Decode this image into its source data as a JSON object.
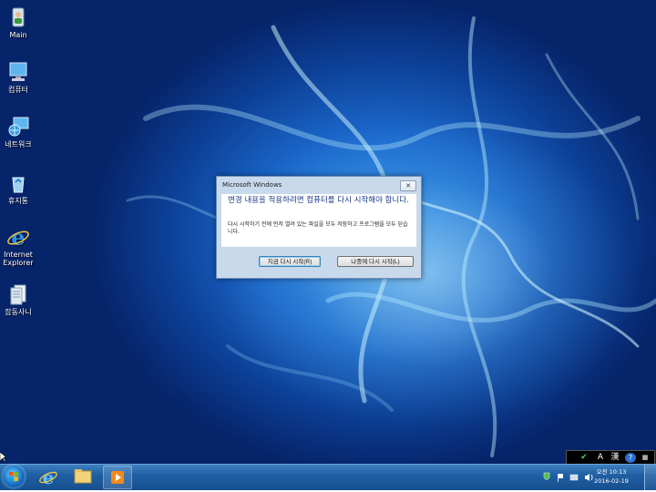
{
  "desktop": {
    "icons": [
      {
        "id": "main",
        "label": "Main"
      },
      {
        "id": "computer",
        "label": "컴퓨터"
      },
      {
        "id": "network",
        "label": "네트워크"
      },
      {
        "id": "recycle-bin",
        "label": "휴지통"
      },
      {
        "id": "ie",
        "label": "Internet Explorer"
      },
      {
        "id": "shared-docs",
        "label": "잡동사니"
      }
    ]
  },
  "dialog": {
    "title": "Microsoft Windows",
    "close_glyph": "✕",
    "main_instruction": "변경 내용을 적용하려면 컴퓨터를 다시 시작해야 합니다.",
    "detail": "다시 시작하기 전에 먼저 열려 있는 파일을 모두 저장하고 프로그램을 모두 닫습니다.",
    "buttons": {
      "restart_now": "지금 다시 시작(R)",
      "restart_later": "나중에 다시 시작(L)"
    }
  },
  "ime_bar": {
    "check": "✔",
    "mode": "A",
    "hanja": "漢",
    "help": "?"
  },
  "taskbar": {
    "clock_time": "오전 10:13",
    "clock_date": "2016-02-19"
  },
  "colors": {
    "dialog_instruction": "#1a3a8a",
    "taskbar": "#1f5fa3"
  }
}
